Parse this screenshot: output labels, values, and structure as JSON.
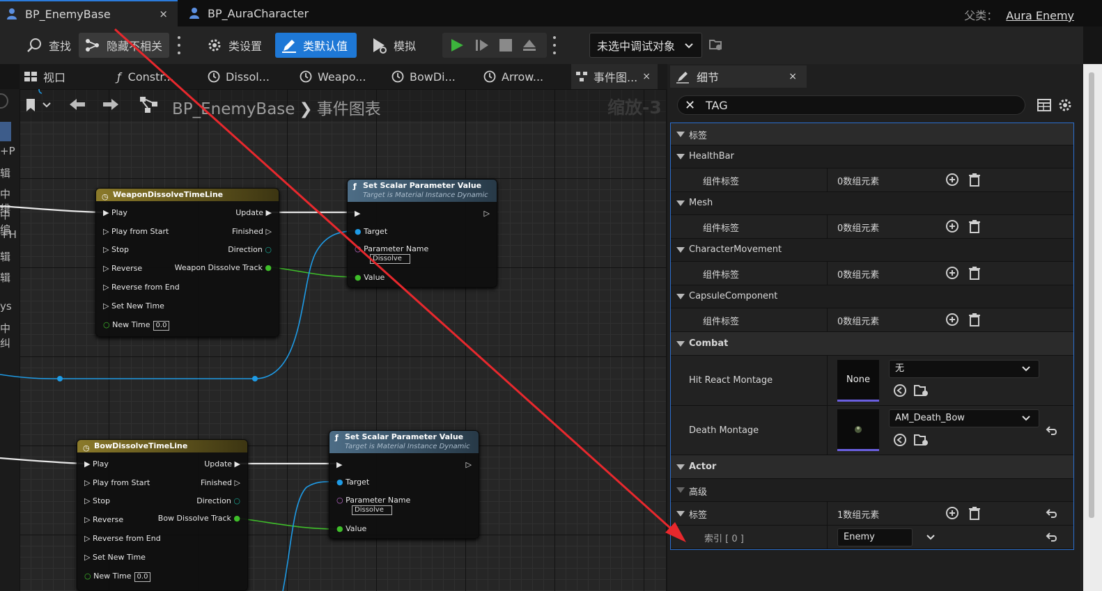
{
  "title_tabs": [
    {
      "label": "BP_EnemyBase",
      "close": "×"
    },
    {
      "label": "BP_AuraCharacter"
    }
  ],
  "parent_class": {
    "label": "父类：",
    "value": "Aura Enemy"
  },
  "toolbar": {
    "find": "查找",
    "hide_unrelated": "隐藏不相关",
    "class_settings": "类设置",
    "class_defaults": "类默认值",
    "simulate": "模拟",
    "debug_target": "未选中调试对象"
  },
  "panel_tabs": [
    {
      "label": "视口"
    },
    {
      "label": "Constr..."
    },
    {
      "label": "Dissol..."
    },
    {
      "label": "Weapo..."
    },
    {
      "label": "BowDi..."
    },
    {
      "label": "Arrow..."
    },
    {
      "label": "事件图...",
      "close": "×"
    }
  ],
  "graph": {
    "breadcrumb_root": "BP_EnemyBase",
    "breadcrumb_sep": "❯",
    "breadcrumb_leaf": "事件图表",
    "zoom": "缩放-3",
    "left_strip": [
      "+P",
      "辑",
      "中绯",
      "中编",
      "+H",
      "辑",
      "辑",
      "ys",
      "中纠"
    ]
  },
  "nodes": {
    "weapon_timeline": {
      "title": "WeaponDissolveTimeLine",
      "in_pins": [
        "Play",
        "Play from Start",
        "Stop",
        "Reverse",
        "Reverse from End",
        "Set New Time",
        "New Time"
      ],
      "new_time_value": "0.0",
      "out_pins": [
        "Update",
        "Finished",
        "Direction",
        "Weapon Dissolve Track"
      ]
    },
    "bow_timeline": {
      "title": "BowDissolveTimeLine",
      "in_pins": [
        "Play",
        "Play from Start",
        "Stop",
        "Reverse",
        "Reverse from End",
        "Set New Time",
        "New Time"
      ],
      "new_time_value": "0.0",
      "out_pins": [
        "Update",
        "Finished",
        "Direction",
        "Bow Dissolve Track"
      ]
    },
    "set_scalar_1": {
      "title": "Set Scalar Parameter Value",
      "subtitle": "Target is Material Instance Dynamic",
      "target": "Target",
      "param_name": "Parameter Name",
      "param_value": "Dissolve",
      "value": "Value"
    },
    "set_scalar_2": {
      "title": "Set Scalar Parameter Value",
      "subtitle": "Target is Material Instance Dynamic",
      "target": "Target",
      "param_name": "Parameter Name",
      "param_value": "Dissolve",
      "value": "Value"
    }
  },
  "details": {
    "tab_label": "细节",
    "close": "×",
    "search_value": "TAG",
    "rows": {
      "cat_tags": "标签",
      "healthbar": "HealthBar",
      "healthbar_tags": "组件标签",
      "healthbar_count": "0数组元素",
      "mesh": "Mesh",
      "mesh_tags": "组件标签",
      "mesh_count": "0数组元素",
      "charmove": "CharacterMovement",
      "charmove_tags": "组件标签",
      "charmove_count": "0数组元素",
      "capsule": "CapsuleComponent",
      "capsule_tags": "组件标签",
      "capsule_count": "0数组元素",
      "combat": "Combat",
      "hit_react": "Hit React Montage",
      "hit_react_thumb": "None",
      "hit_react_value": "无",
      "death": "Death Montage",
      "death_value": "AM_Death_Bow",
      "actor": "Actor",
      "advanced": "高级",
      "actor_tags": "标签",
      "actor_tags_count": "1数组元素",
      "index0": "索引 [ 0 ]",
      "index0_value": "Enemy"
    }
  },
  "colors": {
    "accent_blue": "#1e78d6",
    "annotation_arrow": "#e8282d",
    "exec_wire": "#ffffff",
    "object_wire": "#1e9be6",
    "float_wire": "#3fbe2a"
  }
}
